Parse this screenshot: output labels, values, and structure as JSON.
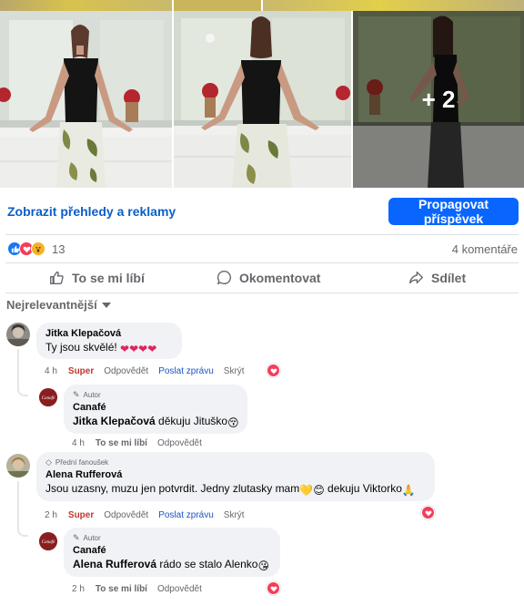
{
  "photos": {
    "more_count": "+ 2"
  },
  "actions_bar": {
    "insights_link": "Zobrazit přehledy a reklamy",
    "boost_button": "Propagovat příspěvek"
  },
  "reactions": {
    "count": "13",
    "comments_count": "4 komentáře",
    "icons": [
      "like-icon",
      "love-icon",
      "wow-icon"
    ]
  },
  "post_actions": {
    "like": "To se mi líbí",
    "comment": "Okomentovat",
    "share": "Sdílet"
  },
  "sort": {
    "label": "Nejrelevantnější"
  },
  "comments": [
    {
      "author": "Jitka Klepačová",
      "text": "Ty jsou skvělé! ",
      "emoji": "❤❤❤❤",
      "time": "4 h",
      "reaction": "Super",
      "reply": "Odpovědět",
      "message": "Poslat zprávu",
      "hide": "Skrýt",
      "replies": [
        {
          "badge": "Autor",
          "author": "Canafé",
          "mention": "Jitka Klepačová",
          "text": " děkuju Jituško",
          "time": "4 h",
          "like": "To se mi líbí",
          "reply": "Odpovědět"
        }
      ]
    },
    {
      "badge": "Přední fanoušek",
      "author": "Alena Rufferová",
      "text": "Jsou uzasny, muzu jen potvrdit. Jedny zlutasky mam",
      "text_after": " dekuju Viktorko",
      "time": "2 h",
      "reaction": "Super",
      "reply": "Odpovědět",
      "message": "Poslat zprávu",
      "hide": "Skrýt",
      "replies": [
        {
          "badge": "Autor",
          "author": "Canafé",
          "mention": "Alena Rufferová",
          "text": " rádo se stalo Alenko",
          "time": "2 h",
          "like": "To se mi líbí",
          "reply": "Odpovědět"
        }
      ]
    }
  ],
  "colors": {
    "accent": "#0866ff",
    "link": "#0a5fc8",
    "super": "#c0392b",
    "heart": "#f33e58"
  }
}
